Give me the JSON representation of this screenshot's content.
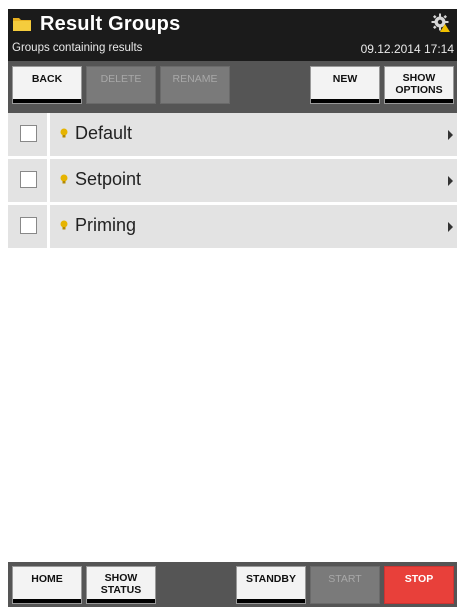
{
  "header": {
    "title": "Result Groups",
    "subtitle": "Groups containing results",
    "datetime": "09.12.2014 17:14",
    "folder_icon": "folder-icon",
    "settings_icon": "gear-warning-icon"
  },
  "toolbar": {
    "back": "BACK",
    "delete": "DELETE",
    "rename": "RENAME",
    "new": "NEW",
    "show_options": "SHOW OPTIONS"
  },
  "groups": [
    {
      "label": "Default"
    },
    {
      "label": "Setpoint"
    },
    {
      "label": "Priming"
    }
  ],
  "bottom_bar": {
    "home": "HOME",
    "show_status": "SHOW STATUS",
    "standby": "STANDBY",
    "start": "START",
    "stop": "STOP"
  },
  "colors": {
    "header_bg": "#1b1b1b",
    "toolbar_bg": "#555555",
    "row_bg": "#e3e3e3",
    "stop_red": "#e8403a",
    "bulb_yellow": "#e6b400"
  }
}
